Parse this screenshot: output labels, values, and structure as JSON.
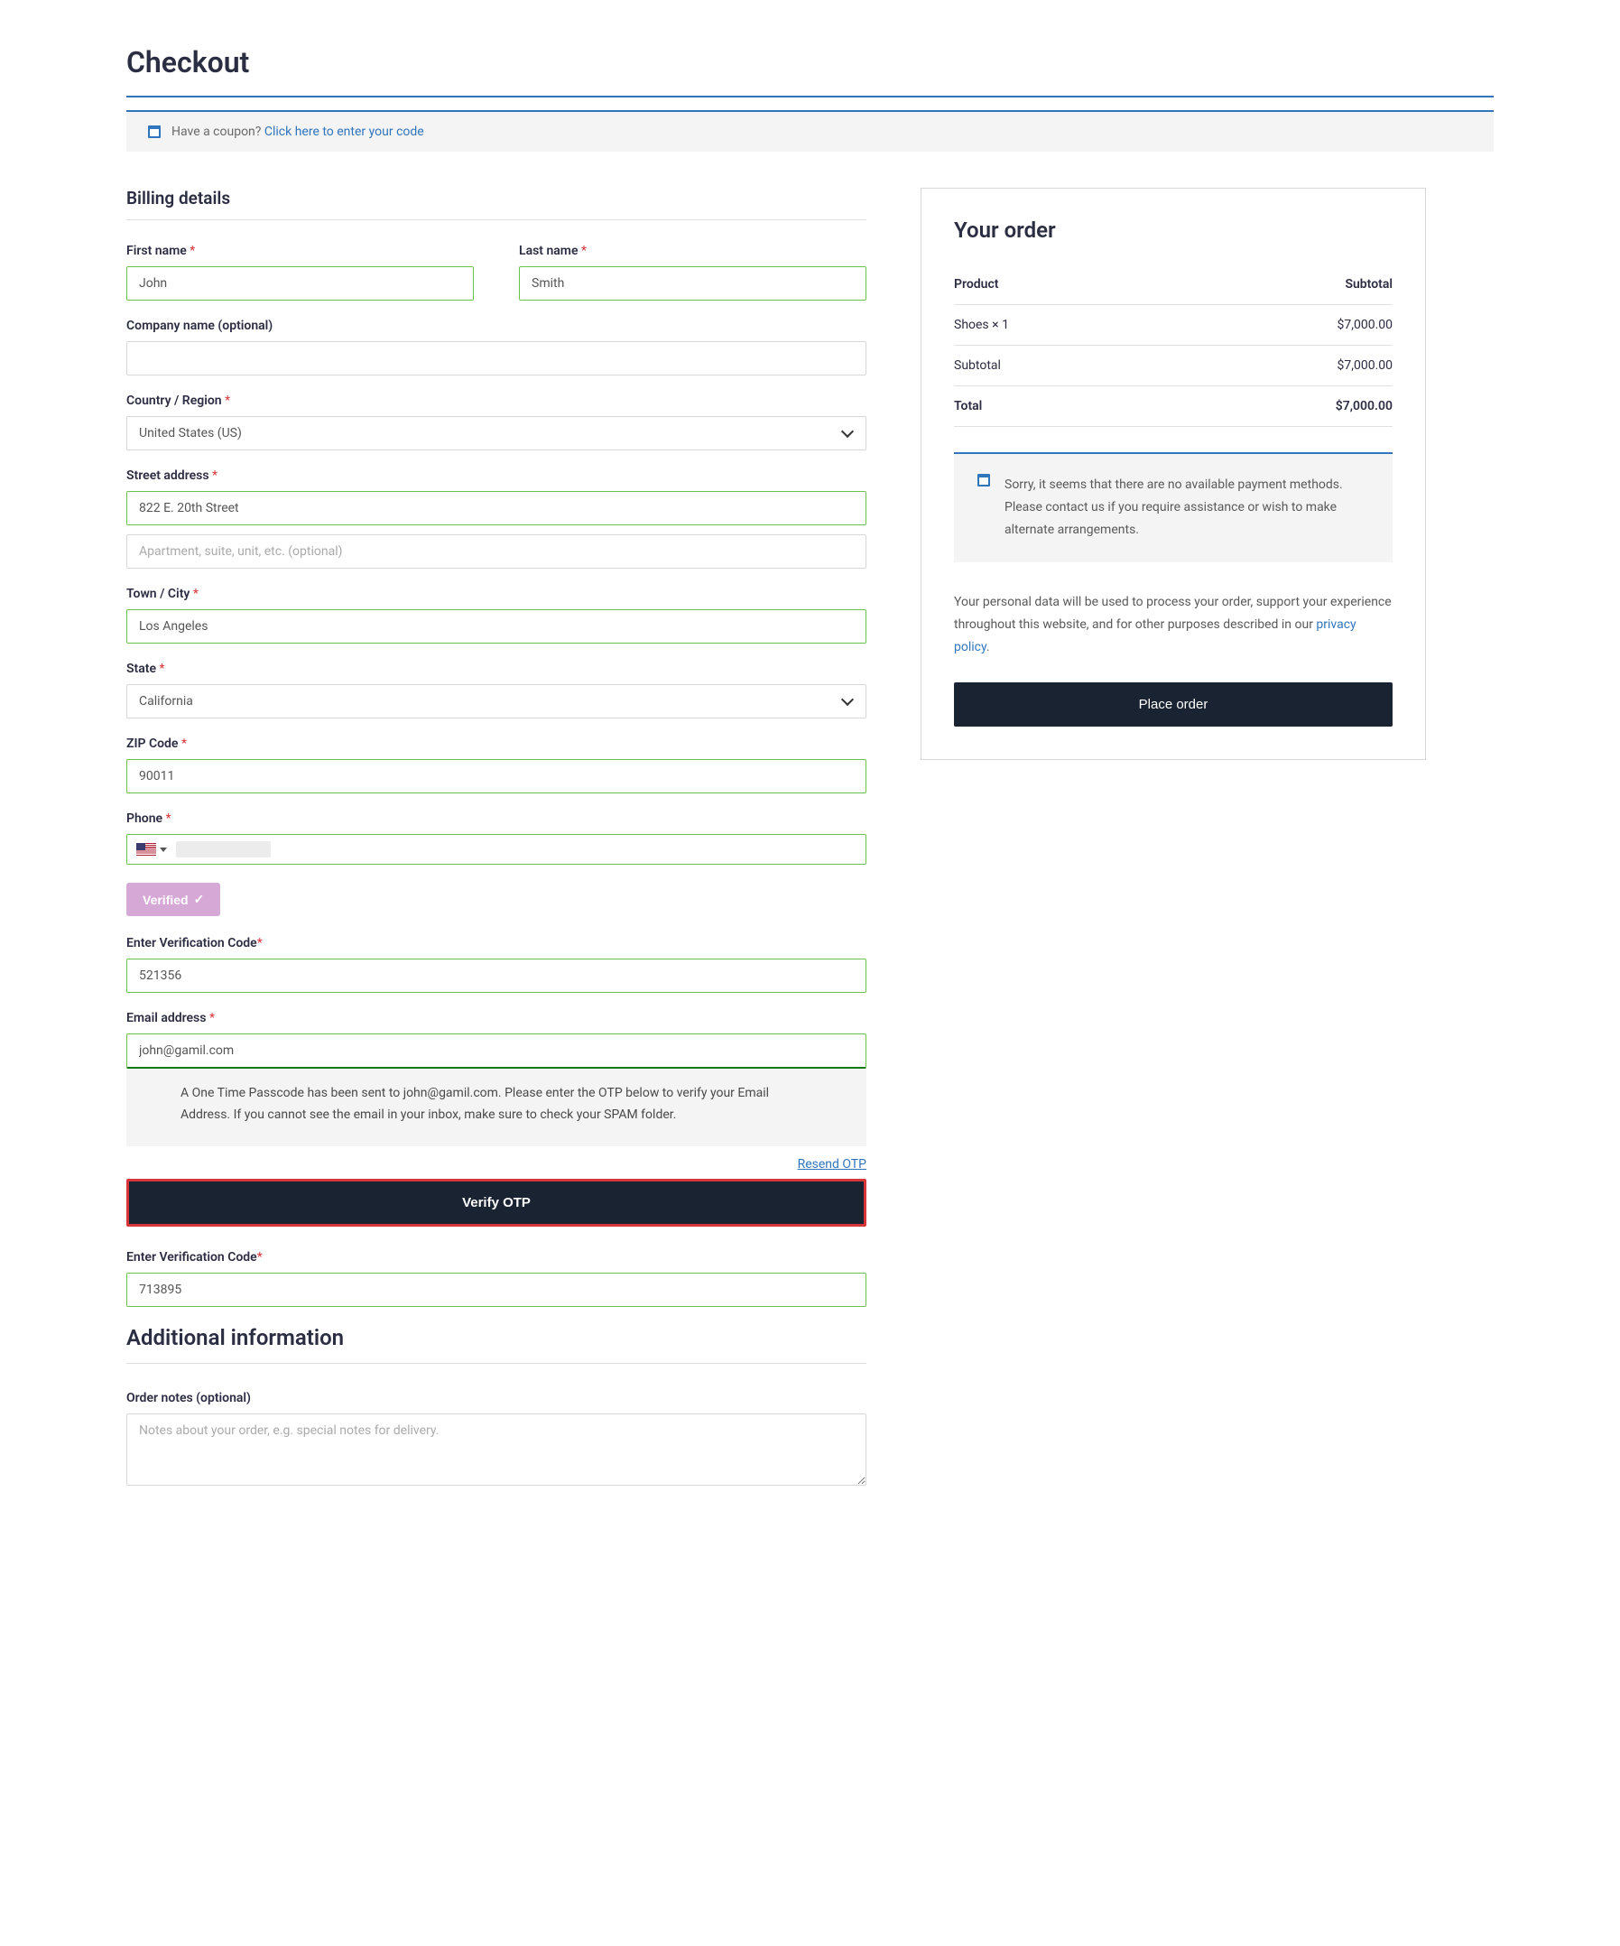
{
  "page_title": "Checkout",
  "coupon": {
    "question": "Have a coupon?",
    "link": "Click here to enter your code"
  },
  "billing": {
    "heading": "Billing details",
    "first_name": {
      "label": "First name",
      "value": "John"
    },
    "last_name": {
      "label": "Last name",
      "value": "Smith"
    },
    "company": {
      "label": "Company name (optional)",
      "value": ""
    },
    "country": {
      "label": "Country / Region",
      "value": "United States (US)"
    },
    "street": {
      "label": "Street address",
      "value": "822 E. 20th Street",
      "placeholder2": "Apartment, suite, unit, etc. (optional)"
    },
    "city": {
      "label": "Town / City",
      "value": "Los Angeles"
    },
    "state": {
      "label": "State",
      "value": "California"
    },
    "zip": {
      "label": "ZIP Code",
      "value": "90011"
    },
    "phone": {
      "label": "Phone"
    },
    "verified": "Verified",
    "verification1": {
      "label": "Enter Verification Code",
      "value": "521356"
    },
    "email": {
      "label": "Email address",
      "value": "john@gamil.com"
    },
    "otp_notice": "A One Time Passcode has been sent to john@gamil.com. Please enter the OTP below to verify your Email Address. If you cannot see the email in your inbox, make sure to check your SPAM folder.",
    "resend": "Resend OTP",
    "verify_button": "Verify OTP",
    "verification2": {
      "label": "Enter Verification Code",
      "value": "713895"
    }
  },
  "additional": {
    "heading": "Additional information",
    "notes": {
      "label": "Order notes (optional)",
      "placeholder": "Notes about your order, e.g. special notes for delivery."
    }
  },
  "order": {
    "heading": "Your order",
    "header_product": "Product",
    "header_subtotal": "Subtotal",
    "item_name": "Shoes  × 1",
    "item_price": "$7,000.00",
    "subtotal_label": "Subtotal",
    "subtotal_value": "$7,000.00",
    "total_label": "Total",
    "total_value": "$7,000.00",
    "notice": "Sorry, it seems that there are no available payment methods. Please contact us if you require assistance or wish to make alternate arrangements.",
    "privacy_text_pre": "Your personal data will be used to process your order, support your experience throughout this website, and for other purposes described in our ",
    "privacy_link": "privacy policy",
    "privacy_text_post": ".",
    "place_order": "Place order"
  }
}
